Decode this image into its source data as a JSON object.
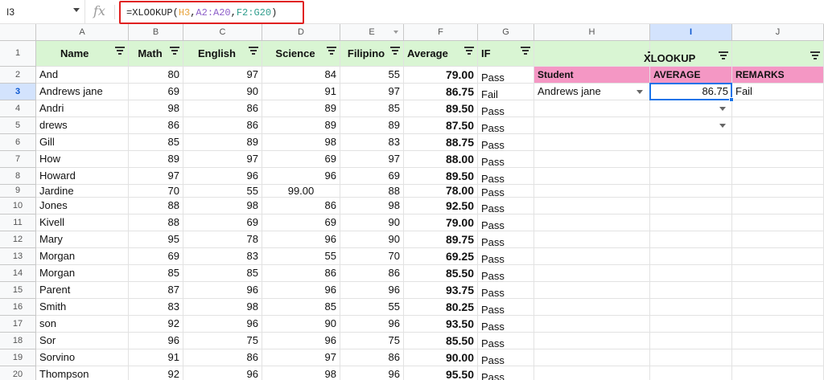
{
  "name_box": "I3",
  "formula": {
    "prefix": "=XLOOKUP(",
    "a1": "H3",
    "s1": ",",
    "a2": "A2:A20",
    "s2": ",",
    "a3": "F2:G20",
    "suffix": ")"
  },
  "fx_label": "fx",
  "columns": [
    "A",
    "B",
    "C",
    "D",
    "E",
    "F",
    "G",
    "H",
    "I",
    "J"
  ],
  "rows": [
    "1",
    "2",
    "3",
    "4",
    "5",
    "6",
    "7",
    "8",
    "9",
    "10",
    "11",
    "12",
    "13",
    "14",
    "15",
    "16",
    "17",
    "18",
    "19",
    "20"
  ],
  "headers": [
    "Name",
    "Math",
    "English",
    "Science",
    "Filipino",
    "Average",
    "IF"
  ],
  "table": [
    [
      "And",
      "80",
      "97",
      "84",
      "55",
      "79.00",
      "Pass"
    ],
    [
      "Andrews jane",
      "69",
      "90",
      "91",
      "97",
      "86.75",
      "Fail"
    ],
    [
      "Andri",
      "98",
      "86",
      "89",
      "85",
      "89.50",
      "Pass"
    ],
    [
      "drews",
      "86",
      "86",
      "89",
      "89",
      "87.50",
      "Pass"
    ],
    [
      "Gill",
      "85",
      "89",
      "98",
      "83",
      "88.75",
      "Pass"
    ],
    [
      "How",
      "89",
      "97",
      "69",
      "97",
      "88.00",
      "Pass"
    ],
    [
      "Howard",
      "97",
      "96",
      "96",
      "69",
      "89.50",
      "Pass"
    ],
    [
      "Jardine",
      "70",
      "55",
      "99.00",
      "88",
      "78.00",
      "Pass"
    ],
    [
      "Jones",
      "88",
      "98",
      "86",
      "98",
      "92.50",
      "Pass"
    ],
    [
      "Kivell",
      "88",
      "69",
      "69",
      "90",
      "79.00",
      "Pass"
    ],
    [
      "Mary",
      "95",
      "78",
      "96",
      "90",
      "89.75",
      "Pass"
    ],
    [
      "Morgan",
      "69",
      "83",
      "55",
      "70",
      "69.25",
      "Pass"
    ],
    [
      "Morgan",
      "85",
      "85",
      "86",
      "86",
      "85.50",
      "Pass"
    ],
    [
      "Parent",
      "87",
      "96",
      "96",
      "96",
      "93.75",
      "Pass"
    ],
    [
      "Smith",
      "83",
      "98",
      "85",
      "55",
      "80.25",
      "Pass"
    ],
    [
      "son",
      "92",
      "96",
      "90",
      "96",
      "93.50",
      "Pass"
    ],
    [
      "Sor",
      "96",
      "75",
      "96",
      "75",
      "85.50",
      "Pass"
    ],
    [
      "Sorvino",
      "91",
      "86",
      "97",
      "86",
      "90.00",
      "Pass"
    ],
    [
      "Thompson",
      "92",
      "96",
      "98",
      "96",
      "95.50",
      "Pass"
    ]
  ],
  "lookup": {
    "title": "XLOOKUP",
    "col_student": "Student",
    "col_average": "AVERAGE",
    "col_remarks": "REMARKS",
    "student": "Andrews jane",
    "average": "86.75",
    "remarks": "Fail"
  },
  "colors": {
    "header_green": "#d9f5d3",
    "lookup_pink": "#f497c4",
    "selection_blue": "#1a73e8",
    "formula_box_red": "#e02020"
  }
}
